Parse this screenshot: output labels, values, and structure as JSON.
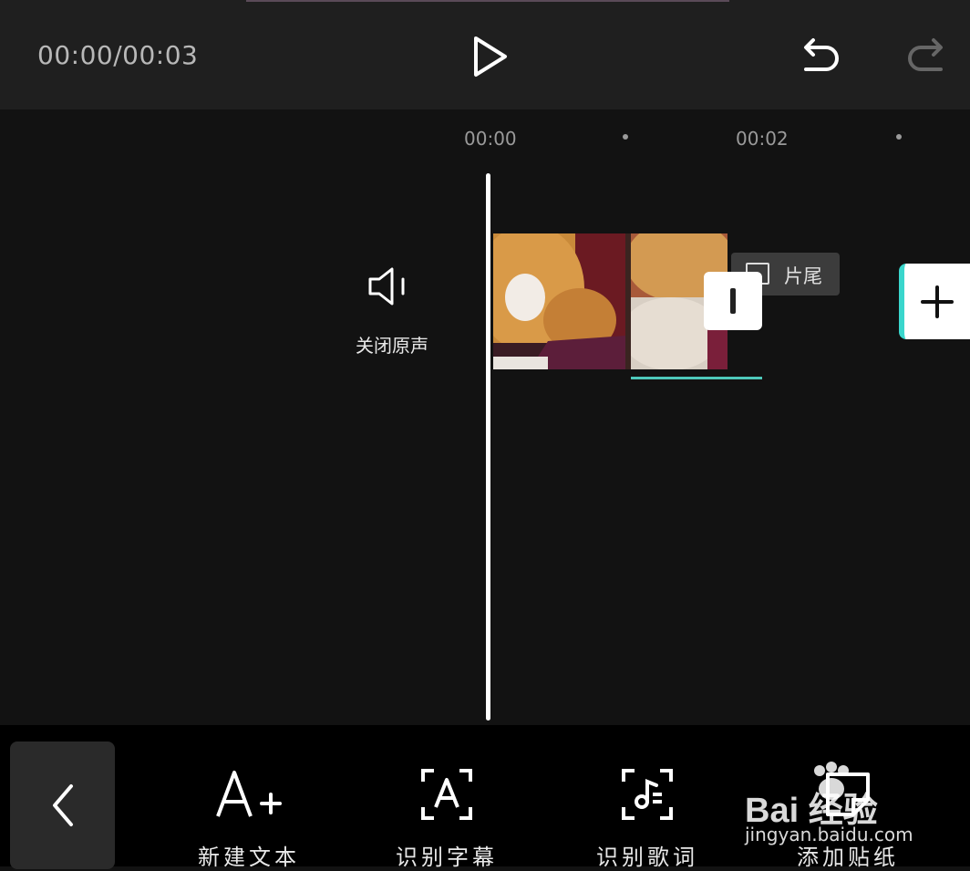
{
  "player": {
    "timecode": "00:00/00:03"
  },
  "ruler": {
    "ticks": [
      "00:00",
      "00:02"
    ]
  },
  "track": {
    "mute_label": "关闭原声",
    "ending_label": "片尾"
  },
  "toolbar": {
    "tools": [
      {
        "label": "新建文本",
        "icon": "text-add-icon"
      },
      {
        "label": "识别字幕",
        "icon": "recognize-subtitle-icon"
      },
      {
        "label": "识别歌词",
        "icon": "recognize-lyrics-icon"
      },
      {
        "label": "添加贴纸",
        "icon": "sticker-icon"
      }
    ]
  },
  "watermark": {
    "main": "Bai 经验",
    "sub": "jingyan.baidu.com"
  },
  "colors": {
    "accent": "#3ad6cc",
    "background": "#121212",
    "topbar": "#1f1f1f"
  }
}
